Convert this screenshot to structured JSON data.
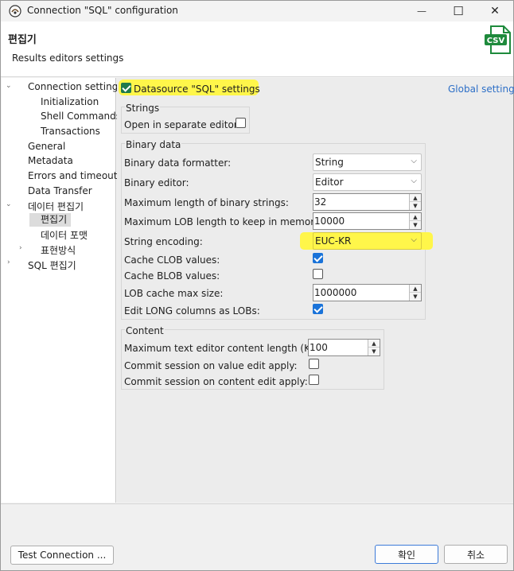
{
  "window": {
    "title": "Connection \"SQL\" configuration",
    "min_icon": "—",
    "max_icon": "☐",
    "close_icon": "✕"
  },
  "header": {
    "title": "편집기",
    "subtitle": "Results editors settings",
    "csv_label": "CSV"
  },
  "tree": {
    "items": [
      {
        "label": "Connection settings"
      },
      {
        "label": "Initialization"
      },
      {
        "label": "Shell Commands"
      },
      {
        "label": "Transactions"
      },
      {
        "label": "General"
      },
      {
        "label": "Metadata"
      },
      {
        "label": "Errors and timeouts"
      },
      {
        "label": "Data Transfer"
      },
      {
        "label": "데이터 편집기"
      },
      {
        "label": "편집기"
      },
      {
        "label": "데이터 포맷"
      },
      {
        "label": "표현방식"
      },
      {
        "label": "SQL 편집기"
      }
    ]
  },
  "datasource": {
    "label": "Datasource \"SQL\" settings",
    "checked": true,
    "global_link": "Global settings"
  },
  "strings_group": {
    "title": "Strings",
    "open_separate": "Open in separate editor:"
  },
  "binary_group": {
    "title": "Binary data",
    "formatter_label": "Binary data formatter:",
    "formatter_value": "String",
    "editor_label": "Binary editor:",
    "editor_value": "Editor",
    "max_binary_label": "Maximum length of binary strings:",
    "max_binary_value": "32",
    "max_lob_label": "Maximum LOB length to keep in memory:",
    "max_lob_value": "10000",
    "encoding_label": "String encoding:",
    "encoding_value": "EUC-KR",
    "cache_clob_label": "Cache CLOB values:",
    "cache_blob_label": "Cache BLOB values:",
    "lob_cache_label": "LOB cache max size:",
    "lob_cache_value": "1000000",
    "edit_long_label": "Edit LONG columns as LOBs:"
  },
  "content_group": {
    "title": "Content",
    "max_text_label": "Maximum text editor content length (KB):",
    "max_text_value": "100",
    "commit_value_label": "Commit session on value edit apply:",
    "commit_content_label": "Commit session on content edit apply:"
  },
  "footer": {
    "test_connection": "Test Connection ...",
    "ok": "확인",
    "cancel": "취소"
  },
  "colors": {
    "highlight": "#fff64a",
    "link": "#2d6fc7",
    "check_blue": "#1a73d9",
    "check_green": "#1f7a4c"
  }
}
